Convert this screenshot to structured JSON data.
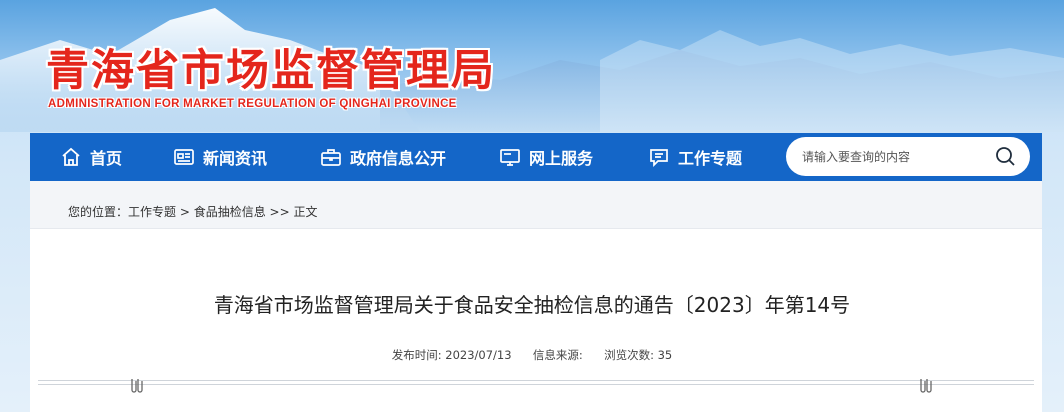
{
  "header": {
    "title": "青海省市场监督管理局",
    "subtitle": "ADMINISTRATION FOR MARKET REGULATION OF QINGHAI PROVINCE"
  },
  "nav": {
    "items": [
      {
        "label": "首页",
        "icon": "home-icon"
      },
      {
        "label": "新闻资讯",
        "icon": "news-icon"
      },
      {
        "label": "政府信息公开",
        "icon": "briefcase-icon"
      },
      {
        "label": "网上服务",
        "icon": "monitor-icon"
      },
      {
        "label": "工作专题",
        "icon": "chat-icon"
      }
    ],
    "search": {
      "placeholder": "请输入要查询的内容",
      "icon": "search-icon"
    }
  },
  "breadcrumb": {
    "prefix": "您的位置：",
    "items": [
      "工作专题",
      "食品抽检信息",
      "正文"
    ],
    "sep1": " > ",
    "sep2": " >> "
  },
  "article": {
    "title": "青海省市场监督管理局关于食品安全抽检信息的通告〔2023〕年第14号",
    "meta": {
      "date_label": "发布时间:",
      "date": "2023/07/13",
      "source_label": "信息来源:",
      "source": "",
      "views_label": "浏览次数:",
      "views": "35"
    }
  },
  "colors": {
    "nav_bg": "#1466c8",
    "title_red": "#e4261c"
  }
}
